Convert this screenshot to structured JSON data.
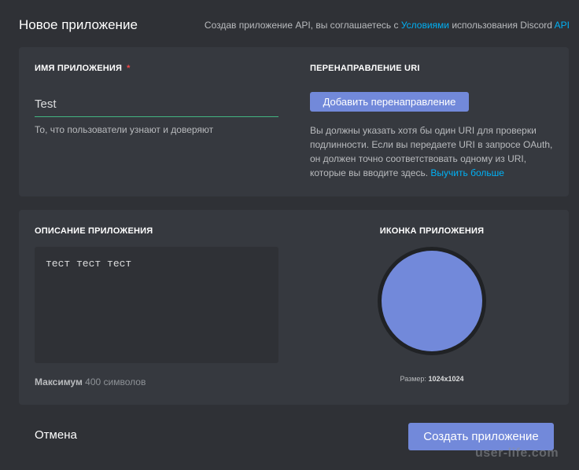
{
  "header": {
    "title": "Новое приложение",
    "terms_prefix": "Создав приложение API, вы соглашаетесь с ",
    "terms_link": "Условиями",
    "terms_middle": " использования Discord ",
    "terms_api": "API"
  },
  "app_name": {
    "label": "Имя приложения",
    "required_mark": "*",
    "value": "Test",
    "hint": "То, что пользователи узнают и доверяют"
  },
  "redirect": {
    "label": "Перенаправление URI",
    "button_label": "Добавить перенаправление",
    "info": "Вы должны указать хотя бы один URI для проверки подлинности. Если вы передаете URI в запросе OAuth, он должен точно соответствовать одному из URI, которые вы вводите здесь. ",
    "learn_more": "Выучить больше"
  },
  "description": {
    "label": "Описание приложения",
    "value": "тест тест тест",
    "limit_prefix": "Максимум ",
    "limit_value": "400 символов"
  },
  "app_icon": {
    "label": "Иконка приложения",
    "size_prefix": "Размер: ",
    "size_value": "1024x1024",
    "color": "#7289da"
  },
  "footer": {
    "cancel": "Отмена",
    "create": "Создать приложение"
  },
  "watermark": "user-life.com",
  "colors": {
    "background": "#2f3136",
    "card": "#36393f",
    "accent": "#7289da",
    "link": "#00b0f4",
    "input_underline": "#43b581",
    "required": "#f04747"
  }
}
